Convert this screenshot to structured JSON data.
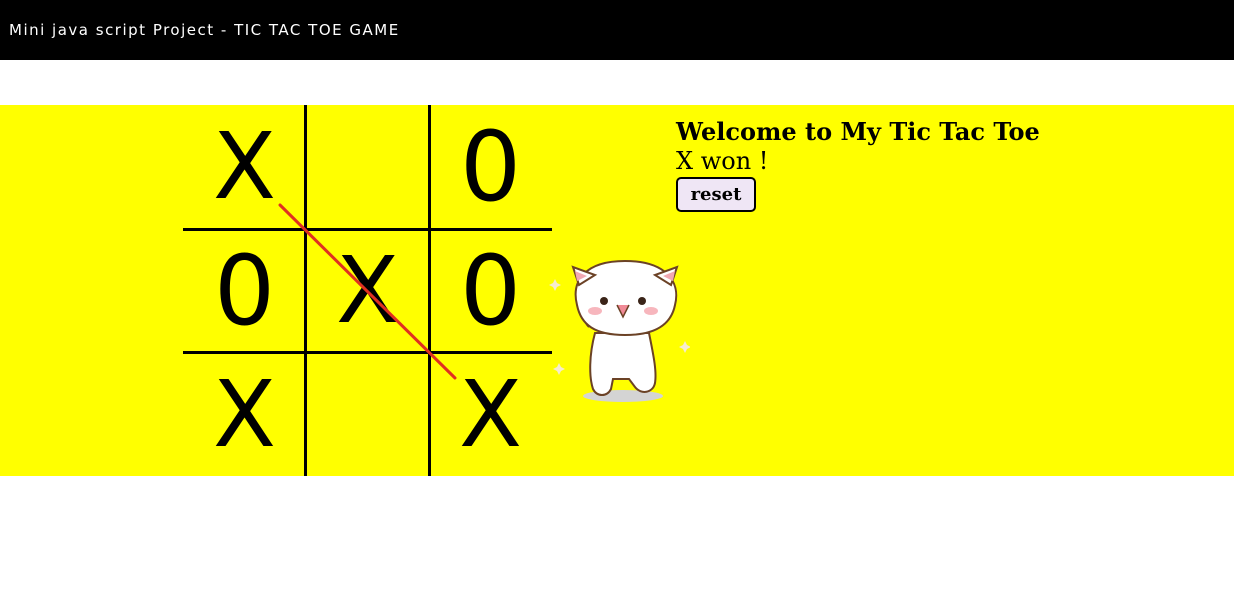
{
  "header": {
    "title": "Mini java script Project - TIC TAC TOE GAME"
  },
  "game": {
    "heading": "Welcome to My Tic Tac Toe",
    "status": "X won !",
    "reset_label": "reset",
    "board": [
      "X",
      "",
      "0",
      "0",
      "X",
      "0",
      "X",
      "",
      "X"
    ],
    "winner": "X",
    "winning_line": [
      0,
      4,
      8
    ]
  },
  "colors": {
    "background": "#ffff00",
    "header": "#000000",
    "win_line": "#e03020",
    "button": "#efe6f5"
  },
  "icons": {
    "mascot": "happy-cat-icon"
  }
}
